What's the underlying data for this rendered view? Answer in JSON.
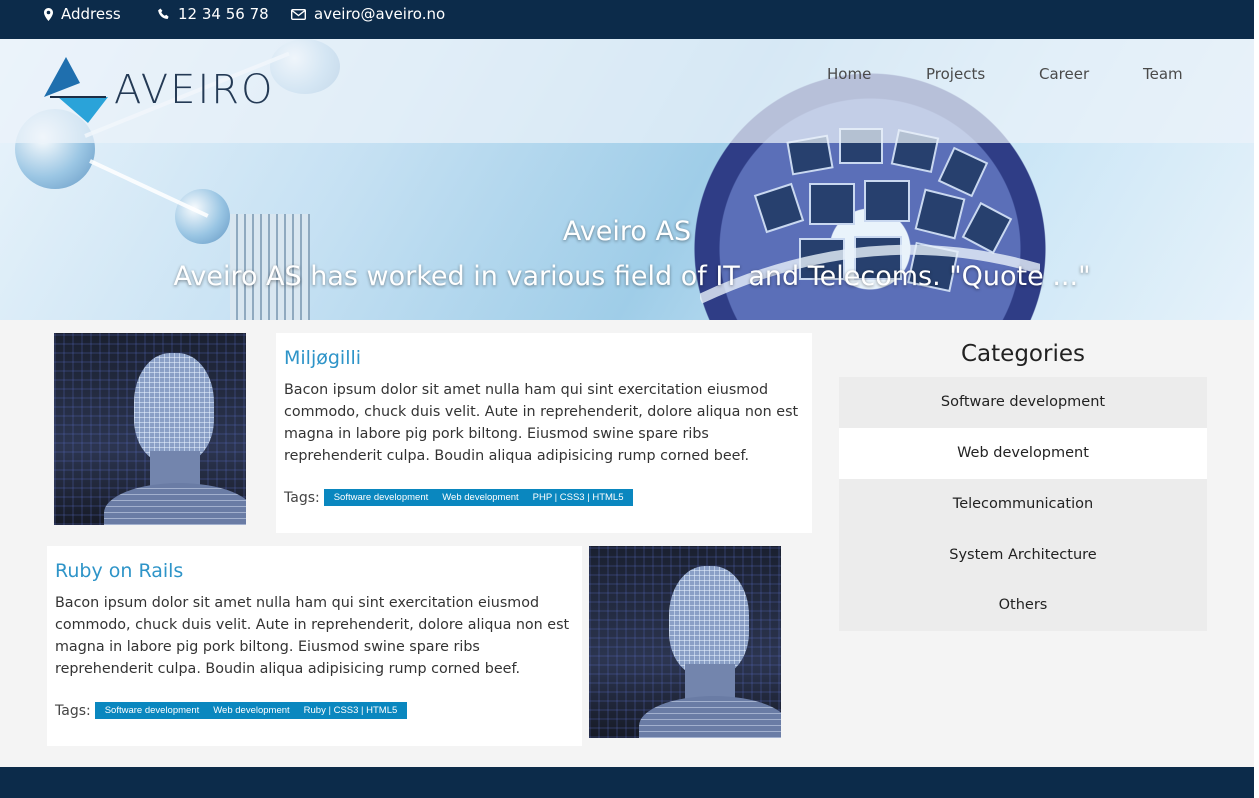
{
  "topbar": {
    "address": "Address",
    "phone": "12 34 56 78",
    "email": "aveiro@aveiro.no"
  },
  "brand": {
    "name": "AVEIRO"
  },
  "nav": {
    "home": "Home",
    "projects": "Projects",
    "career": "Career",
    "team": "Team"
  },
  "hero": {
    "title": "Aveiro AS",
    "subtitle": "Aveiro AS has worked in various field of IT and Telecoms. \"Quote ...\""
  },
  "posts": [
    {
      "title": "Miljøgilli",
      "body": "Bacon ipsum dolor sit amet nulla ham qui sint exercitation eiusmod commodo, chuck duis velit. Aute in reprehenderit, dolore aliqua non est magna in labore pig pork biltong. Eiusmod swine spare ribs reprehenderit culpa. Boudin aliqua adipisicing rump corned beef.",
      "tags_label": "Tags:",
      "tags": [
        "Software development",
        "Web development",
        "PHP | CSS3 | HTML5"
      ]
    },
    {
      "title": "Ruby on Rails",
      "body": "Bacon ipsum dolor sit amet nulla ham qui sint exercitation eiusmod commodo, chuck duis velit. Aute in reprehenderit, dolore aliqua non est magna in labore pig pork biltong. Eiusmod swine spare ribs reprehenderit culpa. Boudin aliqua adipisicing rump corned beef.",
      "tags_label": "Tags:",
      "tags": [
        "Software development",
        "Web development",
        "Ruby | CSS3 | HTML5"
      ]
    }
  ],
  "sidebar": {
    "heading": "Categories",
    "items": [
      "Software development",
      "Web development",
      "Telecommunication",
      "System Architecture",
      "Others"
    ]
  },
  "colors": {
    "navy": "#0c2b4a",
    "accent": "#2e94c8",
    "tag": "#0a87bf"
  }
}
